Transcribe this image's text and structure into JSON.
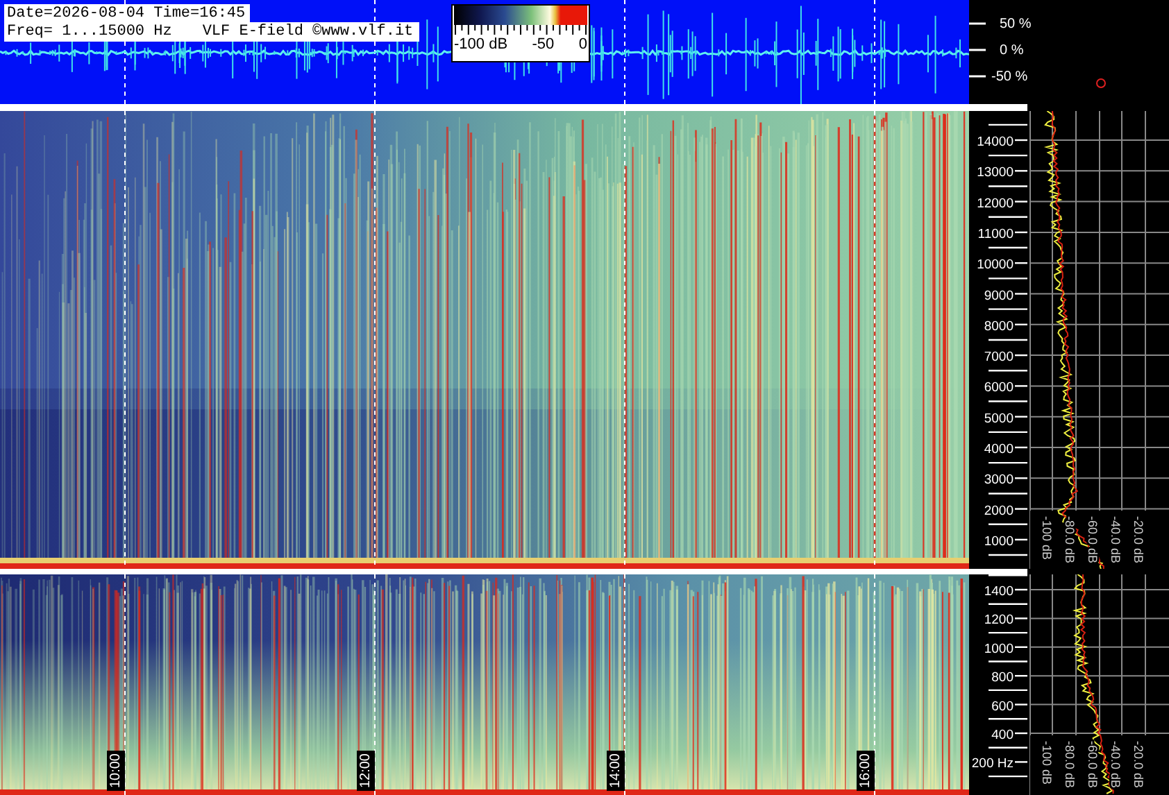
{
  "waveform": {
    "date_time": "Date=2026-08-04 Time=16:45",
    "frequency_range": "Freq= 1...15000 Hz",
    "source": "VLF E-field ©www.vlf.it",
    "color_scale": {
      "labels": [
        "-100 dB",
        "-50",
        "0"
      ]
    }
  },
  "amplitude_axis": [
    "50 %",
    "0 %",
    "-50 %"
  ],
  "spectrogram_upper": {
    "freq_labels": [
      "14000",
      "13000",
      "12000",
      "11000",
      "10000",
      "9000",
      "8000",
      "7000",
      "6000",
      "5000",
      "4000",
      "3000",
      "2000",
      "1000"
    ],
    "db_labels": [
      "-100 dB",
      "-80.0 dB",
      "-60.0 dB",
      "-40.0 dB",
      "-20.0 dB"
    ]
  },
  "spectrogram_lower": {
    "freq_labels": [
      "1400",
      "1200",
      "1000",
      "800",
      "600",
      "400",
      "200 Hz"
    ],
    "db_labels": [
      "-100 dB",
      "-80.0 dB",
      "-60.0 dB",
      "-40.0 dB",
      "-20.0 dB"
    ],
    "time_labels": [
      "10:00",
      "12:00",
      "14:00",
      "16:00"
    ]
  }
}
